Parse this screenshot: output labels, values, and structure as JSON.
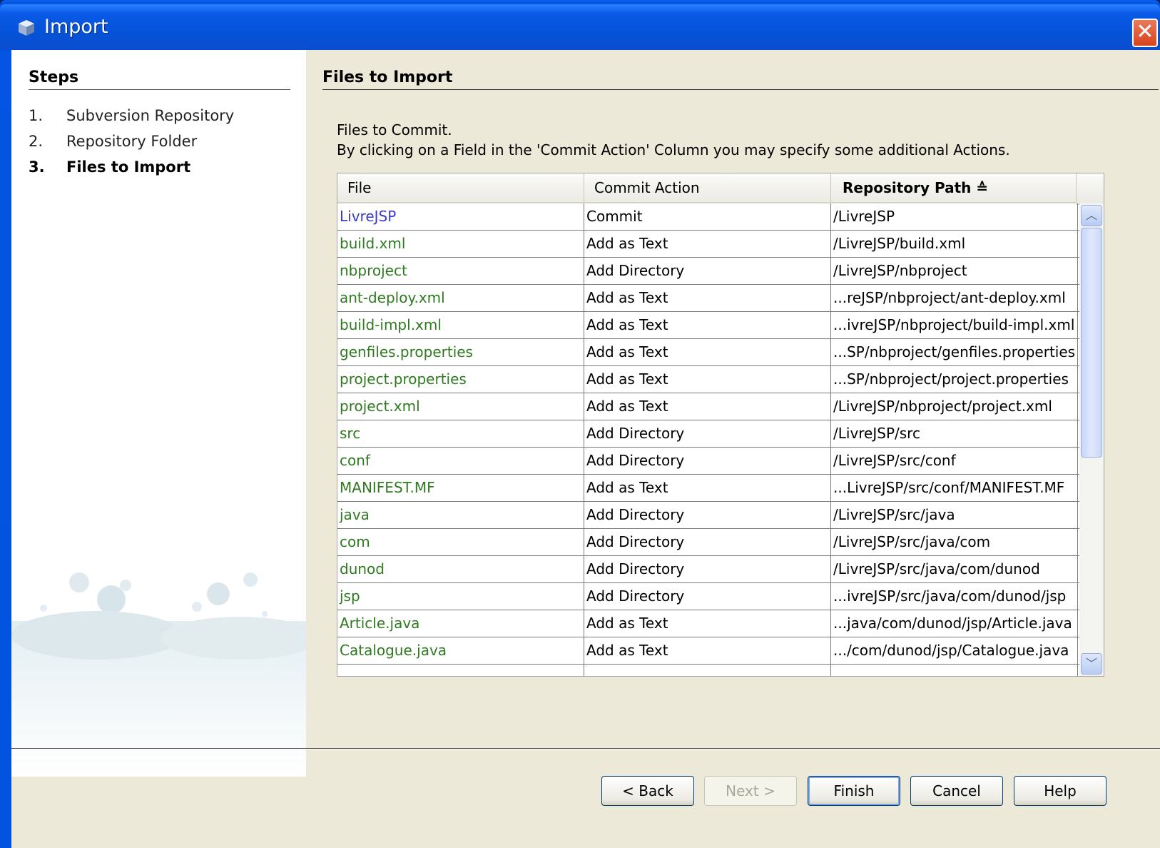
{
  "window": {
    "title": "Import"
  },
  "steps": {
    "heading": "Steps",
    "items": [
      {
        "num": "1.",
        "label": "Subversion Repository"
      },
      {
        "num": "2.",
        "label": "Repository Folder"
      },
      {
        "num": "3.",
        "label": "Files to Import"
      }
    ]
  },
  "main": {
    "title": "Files to Import",
    "desc_line1": "Files to Commit.",
    "desc_line2": "By clicking on a Field in the 'Commit Action' Column you may specify some additional Actions."
  },
  "table": {
    "columns": [
      "File",
      "Commit Action",
      "Repository Path ≙"
    ],
    "rows": [
      {
        "file": "LivreJSP",
        "action": "Commit",
        "path": "/LivreJSP"
      },
      {
        "file": "build.xml",
        "action": "Add as Text",
        "path": "/LivreJSP/build.xml"
      },
      {
        "file": "nbproject",
        "action": "Add Directory",
        "path": "/LivreJSP/nbproject"
      },
      {
        "file": "ant-deploy.xml",
        "action": "Add as Text",
        "path": "...reJSP/nbproject/ant-deploy.xml"
      },
      {
        "file": "build-impl.xml",
        "action": "Add as Text",
        "path": "...ivreJSP/nbproject/build-impl.xml"
      },
      {
        "file": "genfiles.properties",
        "action": "Add as Text",
        "path": "...SP/nbproject/genfiles.properties"
      },
      {
        "file": "project.properties",
        "action": "Add as Text",
        "path": "...SP/nbproject/project.properties"
      },
      {
        "file": "project.xml",
        "action": "Add as Text",
        "path": "/LivreJSP/nbproject/project.xml"
      },
      {
        "file": "src",
        "action": "Add Directory",
        "path": "/LivreJSP/src"
      },
      {
        "file": "conf",
        "action": "Add Directory",
        "path": "/LivreJSP/src/conf"
      },
      {
        "file": "MANIFEST.MF",
        "action": "Add as Text",
        "path": "...LivreJSP/src/conf/MANIFEST.MF"
      },
      {
        "file": "java",
        "action": "Add Directory",
        "path": "/LivreJSP/src/java"
      },
      {
        "file": "com",
        "action": "Add Directory",
        "path": "/LivreJSP/src/java/com"
      },
      {
        "file": "dunod",
        "action": "Add Directory",
        "path": "/LivreJSP/src/java/com/dunod"
      },
      {
        "file": "jsp",
        "action": "Add Directory",
        "path": "...ivreJSP/src/java/com/dunod/jsp"
      },
      {
        "file": "Article.java",
        "action": "Add as Text",
        "path": "...java/com/dunod/jsp/Article.java"
      },
      {
        "file": "Catalogue.java",
        "action": "Add as Text",
        "path": ".../com/dunod/jsp/Catalogue.java"
      }
    ]
  },
  "buttons": {
    "back": "< Back",
    "next": "Next >",
    "finish": "Finish",
    "cancel": "Cancel",
    "help": "Help"
  },
  "icons": {
    "app": "cube-icon",
    "close": "close-icon",
    "scroll_up": "chevron-up-icon",
    "scroll_down": "chevron-down-icon"
  }
}
